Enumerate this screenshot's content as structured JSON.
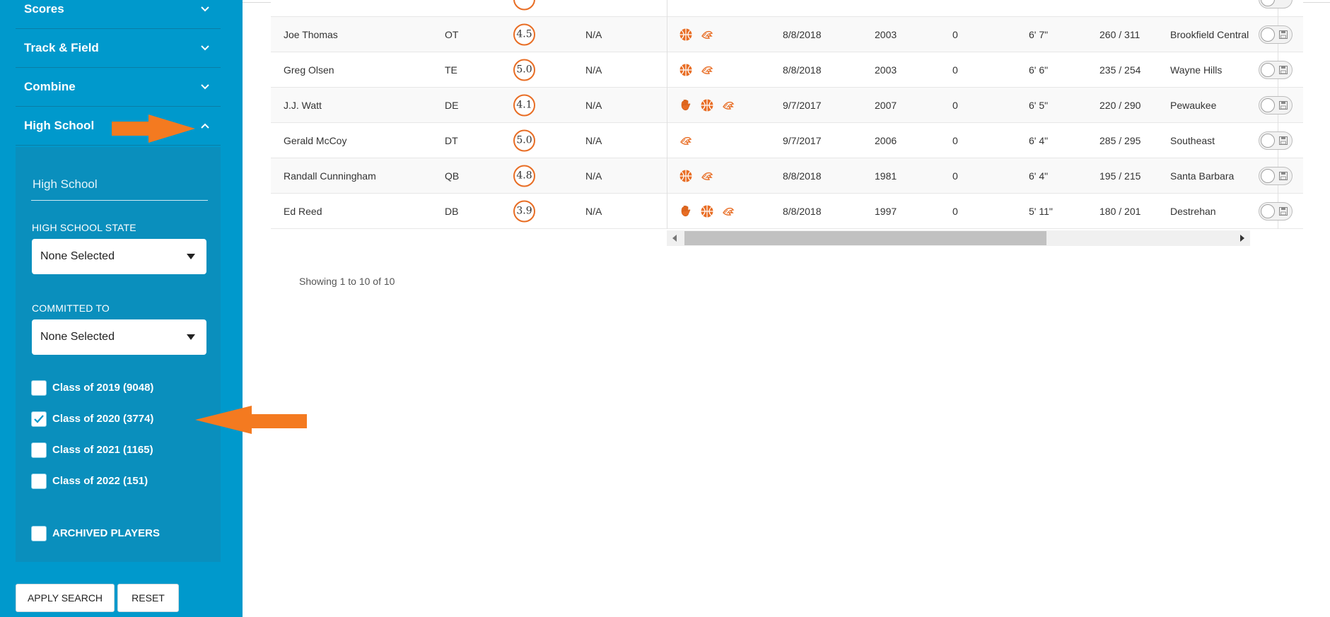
{
  "accent": "#e86d24",
  "sidebar_bg": "#0099cc",
  "sidebar": {
    "sections": [
      {
        "label": "Scores",
        "expanded": false
      },
      {
        "label": "Track & Field",
        "expanded": false
      },
      {
        "label": "Combine",
        "expanded": false
      },
      {
        "label": "High School",
        "expanded": true
      }
    ],
    "high_school": {
      "input_placeholder": "High School",
      "state_label": "HIGH SCHOOL STATE",
      "state_value": "None Selected",
      "committed_label": "COMMITTED TO",
      "committed_value": "None Selected",
      "classes": [
        {
          "label": "Class of 2019 (9048)",
          "checked": false
        },
        {
          "label": "Class of 2020 (3774)",
          "checked": true
        },
        {
          "label": "Class of 2021 (1165)",
          "checked": false
        },
        {
          "label": "Class of 2022 (151)",
          "checked": false
        }
      ],
      "archived_label": "ARCHIVED PLAYERS",
      "archived_checked": false
    },
    "buttons": {
      "apply": "APPLY SEARCH",
      "reset": "RESET"
    }
  },
  "table": {
    "rows": [
      {
        "name": "Joe Thomas",
        "pos": "OT",
        "score": "4.5",
        "na": "N/A",
        "icons": [
          "basketball-icon",
          "track-icon"
        ],
        "date": "8/8/2018",
        "year": "2003",
        "zero": "0",
        "height": "6' 7\"",
        "weight": "260 / 311",
        "school": "Brookfield Central"
      },
      {
        "name": "Greg Olsen",
        "pos": "TE",
        "score": "5.0",
        "na": "N/A",
        "icons": [
          "basketball-icon",
          "track-icon"
        ],
        "date": "8/8/2018",
        "year": "2003",
        "zero": "0",
        "height": "6' 6\"",
        "weight": "235 / 254",
        "school": "Wayne Hills"
      },
      {
        "name": "J.J. Watt",
        "pos": "DE",
        "score": "4.1",
        "na": "N/A",
        "icons": [
          "hand-icon",
          "basketball-icon",
          "track-icon"
        ],
        "date": "9/7/2017",
        "year": "2007",
        "zero": "0",
        "height": "6' 5\"",
        "weight": "220 / 290",
        "school": "Pewaukee"
      },
      {
        "name": "Gerald McCoy",
        "pos": "DT",
        "score": "5.0",
        "na": "N/A",
        "icons": [
          "track-icon"
        ],
        "date": "9/7/2017",
        "year": "2006",
        "zero": "0",
        "height": "6' 4\"",
        "weight": "285 / 295",
        "school": "Southeast"
      },
      {
        "name": "Randall Cunningham",
        "pos": "QB",
        "score": "4.8",
        "na": "N/A",
        "icons": [
          "basketball-icon",
          "track-icon"
        ],
        "date": "8/8/2018",
        "year": "1981",
        "zero": "0",
        "height": "6' 4\"",
        "weight": "195 / 215",
        "school": "Santa Barbara"
      },
      {
        "name": "Ed Reed",
        "pos": "DB",
        "score": "3.9",
        "na": "N/A",
        "icons": [
          "hand-icon",
          "basketball-icon",
          "track-icon"
        ],
        "date": "8/8/2018",
        "year": "1997",
        "zero": "0",
        "height": "5' 11\"",
        "weight": "180 / 201",
        "school": "Destrehan"
      }
    ],
    "showing": "Showing 1 to 10 of 10"
  }
}
